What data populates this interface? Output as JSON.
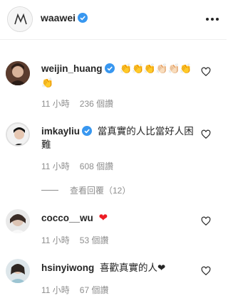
{
  "post": {
    "username": "waawei"
  },
  "comments": [
    {
      "username": "weijin_huang",
      "text": "👏👏👏👏🏻👏🏻👏👏",
      "time": "11 小時",
      "likes": "236 個讚"
    },
    {
      "username": "imkayliu",
      "text": "當真實的人比當好人困難",
      "time": "11 小時",
      "likes": "608 個讚"
    },
    {
      "username": "cocco__wu",
      "text": "❤",
      "time": "11 小時",
      "likes": "53 個讚"
    },
    {
      "username": "hsinyiwong",
      "text": "喜歡真實的人❤",
      "time": "11 小時",
      "likes": "67 個讚"
    }
  ],
  "view_replies": "查看回覆（12）",
  "colors": {
    "verified": "#3897f0",
    "heart": "#ed1c24",
    "meta": "#8e8e8e"
  }
}
